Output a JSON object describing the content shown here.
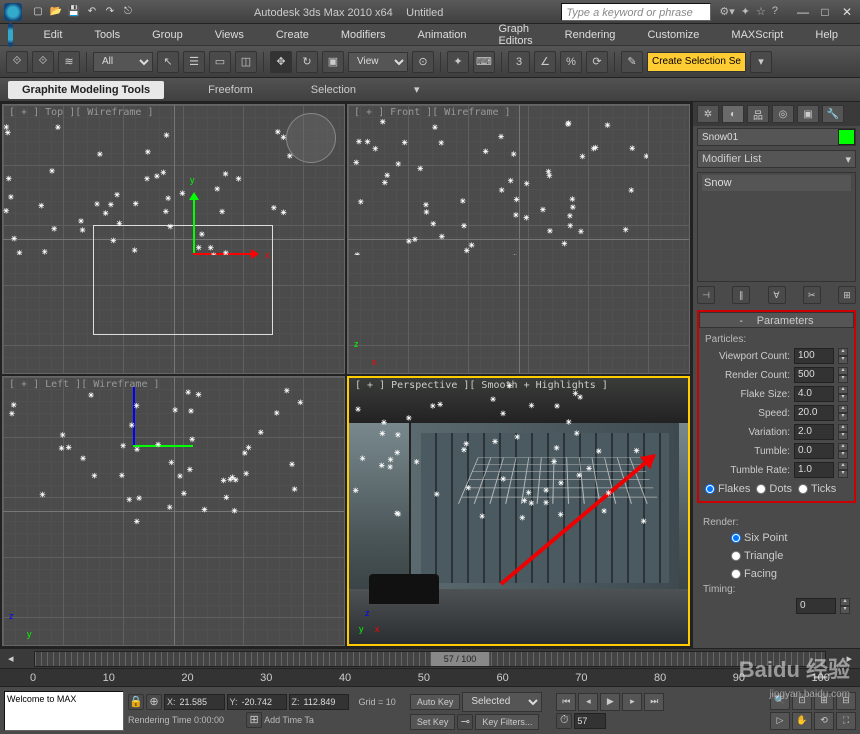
{
  "title": {
    "app": "Autodesk 3ds Max  2010 x64",
    "doc": "Untitled",
    "search_placeholder": "Type a keyword or phrase"
  },
  "menu": [
    "Edit",
    "Tools",
    "Group",
    "Views",
    "Create",
    "Modifiers",
    "Animation",
    "Graph Editors",
    "Rendering",
    "Customize",
    "MAXScript",
    "Help"
  ],
  "toolbar": {
    "sel_filter": "All",
    "ref_system": "View",
    "create_btn": "Create Selection Se"
  },
  "ribbon": [
    "Graphite Modeling Tools",
    "Freeform",
    "Selection"
  ],
  "viewports": {
    "top": "[ + ] Top ][ Wireframe ]",
    "front": "[ + ] Front ][ Wireframe ]",
    "left": "[ + ] Left ][ Wireframe ]",
    "persp": "[ + ] Perspective ][ Smooth + Highlights ]"
  },
  "command_panel": {
    "object_name": "Snow01",
    "modifier_list": "Modifier List",
    "stack": [
      "Snow"
    ],
    "rollout_parameters": "Parameters",
    "particles_label": "Particles:",
    "params": {
      "viewport_count": {
        "label": "Viewport Count:",
        "value": "100"
      },
      "render_count": {
        "label": "Render Count:",
        "value": "500"
      },
      "flake_size": {
        "label": "Flake Size:",
        "value": "4.0"
      },
      "speed": {
        "label": "Speed:",
        "value": "20.0"
      },
      "variation": {
        "label": "Variation:",
        "value": "2.0"
      },
      "tumble": {
        "label": "Tumble:",
        "value": "0.0"
      },
      "tumble_rate": {
        "label": "Tumble Rate:",
        "value": "1.0"
      }
    },
    "shape_radios": [
      "Flakes",
      "Dots",
      "Ticks"
    ],
    "render_label": "Render:",
    "render_radios": [
      "Six Point",
      "Triangle",
      "Facing"
    ],
    "timing_label": "Timing:",
    "timing_start": "0"
  },
  "timeline": {
    "current": "57 / 100",
    "ticks": [
      "0",
      "10",
      "20",
      "30",
      "40",
      "50",
      "60",
      "70",
      "80",
      "90",
      "100"
    ]
  },
  "status": {
    "script": "Welcome to MAX",
    "coords": {
      "x": "21.585",
      "y": "-20.742",
      "z": "112.849"
    },
    "grid": "Grid = 10",
    "render_time": "Rendering Time 0:00:00",
    "add_time": "Add Time Ta",
    "auto_key": "Auto Key",
    "set_key": "Set Key",
    "selected": "Selected",
    "key_filters": "Key Filters..."
  },
  "watermark": {
    "main": "Baidu 经验",
    "sub": "jingyan.baidu.com"
  }
}
